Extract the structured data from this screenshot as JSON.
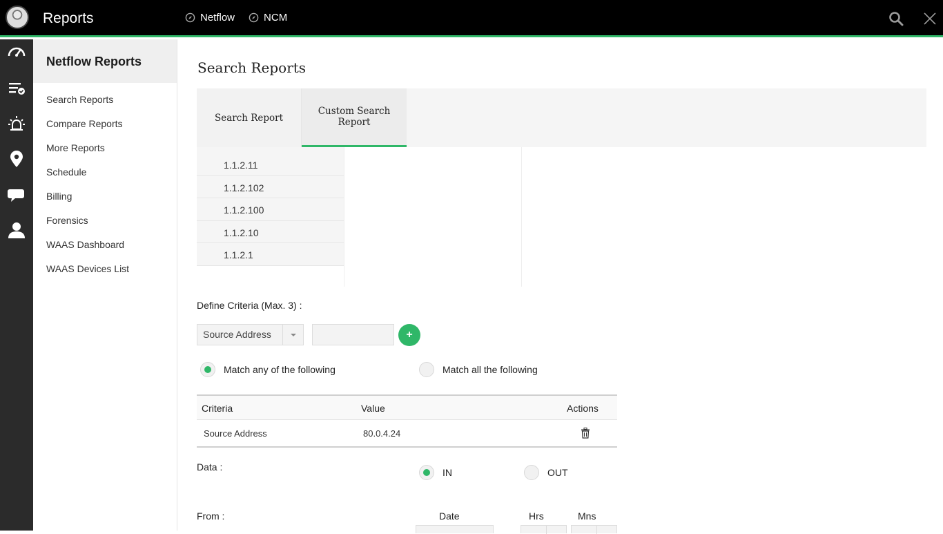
{
  "app": {
    "title": "Reports"
  },
  "topnav": [
    {
      "label": "Netflow"
    },
    {
      "label": "NCM"
    }
  ],
  "sidebar": {
    "header": "Netflow Reports",
    "items": [
      {
        "label": "Search Reports"
      },
      {
        "label": "Compare Reports"
      },
      {
        "label": "More Reports"
      },
      {
        "label": "Schedule"
      },
      {
        "label": "Billing"
      },
      {
        "label": "Forensics"
      },
      {
        "label": "WAAS Dashboard"
      },
      {
        "label": "WAAS Devices List"
      }
    ]
  },
  "main": {
    "title": "Search Reports",
    "tabs": [
      {
        "label": "Search Report",
        "active": false
      },
      {
        "label": "Custom Search Report",
        "active": true
      }
    ],
    "ip_list": [
      "1.1.2.11",
      "1.1.2.102",
      "1.1.2.100",
      "1.1.2.10",
      "1.1.2.1"
    ],
    "criteria_label": "Define Criteria (Max. 3) :",
    "criteria_select": {
      "value": "Source Address"
    },
    "criteria_input": {
      "value": ""
    },
    "add_button": "+",
    "match": {
      "any_label": "Match any of the following",
      "all_label": "Match all the following",
      "selected": "any"
    },
    "table": {
      "headers": {
        "criteria": "Criteria",
        "value": "Value",
        "actions": "Actions"
      },
      "rows": [
        {
          "criteria": "Source Address",
          "value": "80.0.4.24"
        }
      ]
    },
    "data": {
      "label": "Data :",
      "in_label": "IN",
      "out_label": "OUT",
      "selected": "IN"
    },
    "from": {
      "label": "From :",
      "date_header": "Date",
      "hrs_header": "Hrs",
      "mns_header": "Mns"
    }
  },
  "colors": {
    "accent": "#2fb768",
    "topbar": "#000000",
    "rail": "#2b2b2b"
  },
  "icons": {
    "rail": [
      "dashboard-gauge-icon",
      "tasks-list-icon",
      "alarm-icon",
      "location-pin-icon",
      "chat-icon",
      "user-icon"
    ],
    "topbar": [
      "search-icon",
      "close-icon"
    ]
  }
}
